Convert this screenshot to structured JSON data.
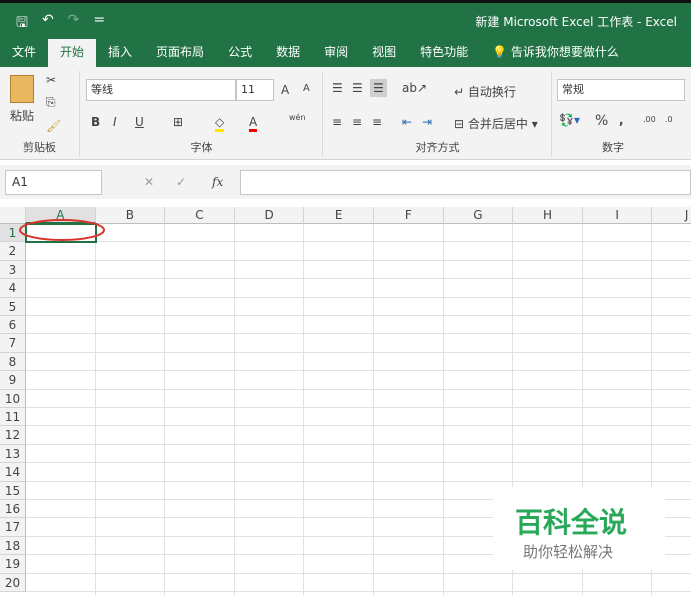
{
  "title": "新建 Microsoft Excel 工作表  -  Excel",
  "qat": {
    "save": "🖫",
    "undo": "↶",
    "redo": "↷",
    "customize": "="
  },
  "tabs": [
    "文件",
    "开始",
    "插入",
    "页面布局",
    "公式",
    "数据",
    "审阅",
    "视图",
    "特色功能"
  ],
  "tell_me": "告诉我你想要做什么",
  "clipboard": {
    "paste": "粘贴",
    "label": "剪贴板"
  },
  "font": {
    "name": "等线",
    "size": "11",
    "label": "字体",
    "bold": "B",
    "italic": "I",
    "underline": "U",
    "grow": "A",
    "shrink": "A",
    "phonetic": "wén"
  },
  "alignment": {
    "wrap": "自动换行",
    "merge": "合并后居中",
    "label": "对齐方式"
  },
  "number": {
    "format": "常规",
    "percent": "%",
    "comma": ",",
    "inc": ".00",
    "dec": ".0",
    "label": "数字"
  },
  "formula_bar": {
    "name_box": "A1",
    "fx": "fx",
    "cancel": "✕",
    "enter": "✓",
    "value": ""
  },
  "columns": [
    "A",
    "B",
    "C",
    "D",
    "E",
    "F",
    "G",
    "H",
    "I",
    "J"
  ],
  "rows": [
    "1",
    "2",
    "3",
    "4",
    "5",
    "6",
    "7",
    "8",
    "9",
    "10",
    "11",
    "12",
    "13",
    "14",
    "15",
    "16",
    "17",
    "18",
    "19",
    "20"
  ],
  "watermark": {
    "title": "百科全说",
    "subtitle": "助你轻松解决"
  },
  "colors": {
    "brand": "#217346",
    "ellipse": "#d9342b"
  }
}
